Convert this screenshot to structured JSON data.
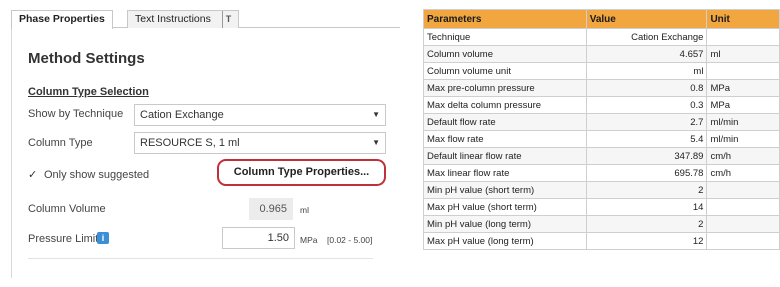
{
  "tabs": [
    {
      "label": "Phase Properties"
    },
    {
      "label": "Text Instructions",
      "pin": "T"
    }
  ],
  "method_settings": {
    "title": "Method Settings",
    "section_title": "Column Type Selection",
    "show_by_technique": {
      "label": "Show by Technique",
      "value": "Cation Exchange"
    },
    "column_type": {
      "label": "Column Type",
      "value": "RESOURCE S, 1 ml"
    },
    "only_suggested": {
      "label": "Only show suggested",
      "checked": true
    },
    "column_type_properties_button": "Column Type Properties...",
    "column_volume": {
      "label": "Column Volume",
      "value": "0.965",
      "unit": "ml"
    },
    "pressure_limit": {
      "label": "Pressure Limit",
      "value": "1.50",
      "unit": "MPa",
      "range": "[0.02 - 5.00]"
    }
  },
  "parameters_table": {
    "headers": [
      "Parameters",
      "Value",
      "Unit"
    ],
    "rows": [
      {
        "param": "Technique",
        "value": "Cation Exchange",
        "unit": ""
      },
      {
        "param": "Column volume",
        "value": "4.657",
        "unit": "ml"
      },
      {
        "param": "Column volume unit",
        "value": "ml",
        "unit": ""
      },
      {
        "param": "Max pre-column pressure",
        "value": "0.8",
        "unit": "MPa"
      },
      {
        "param": "Max delta column pressure",
        "value": "0.3",
        "unit": "MPa"
      },
      {
        "param": "Default flow rate",
        "value": "2.7",
        "unit": "ml/min"
      },
      {
        "param": "Max flow rate",
        "value": "5.4",
        "unit": "ml/min"
      },
      {
        "param": "Default linear flow rate",
        "value": "347.89",
        "unit": "cm/h"
      },
      {
        "param": "Max linear flow rate",
        "value": "695.78",
        "unit": "cm/h"
      },
      {
        "param": "Min pH value (short term)",
        "value": "2",
        "unit": ""
      },
      {
        "param": "Max pH value (short term)",
        "value": "14",
        "unit": ""
      },
      {
        "param": "Min pH value (long term)",
        "value": "2",
        "unit": ""
      },
      {
        "param": "Max pH value (long term)",
        "value": "12",
        "unit": ""
      }
    ]
  },
  "colors": {
    "header_bg": "#f2a640",
    "highlight_border": "#c0303a",
    "info_icon": "#3a8fd6"
  }
}
